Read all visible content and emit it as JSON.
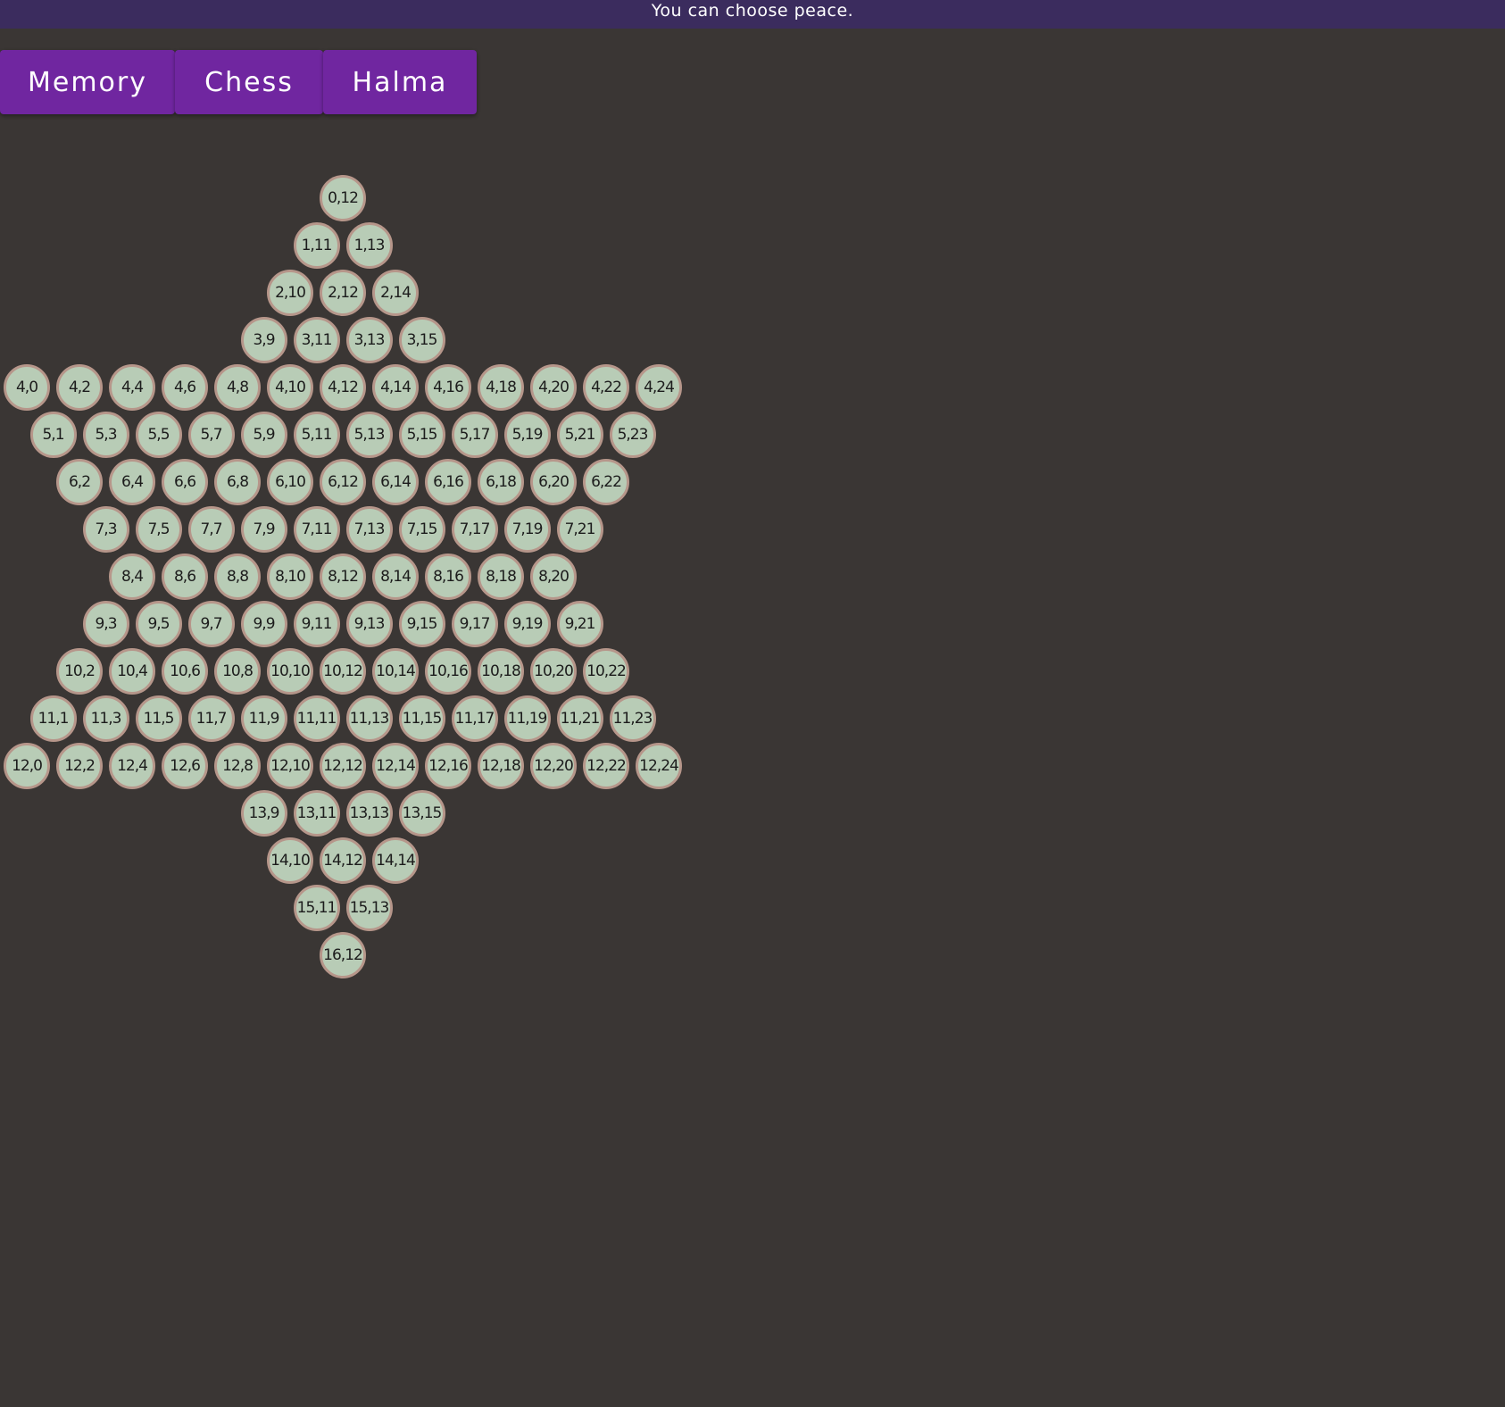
{
  "banner": {
    "text": "You can choose peace."
  },
  "menu": {
    "buttons": [
      {
        "name": "memory-button",
        "label": "Memory"
      },
      {
        "name": "chess-button",
        "label": "Chess"
      },
      {
        "name": "halma-button",
        "label": "Halma"
      }
    ]
  },
  "board": {
    "rows": [
      {
        "row": 0,
        "cols": [
          12
        ]
      },
      {
        "row": 1,
        "cols": [
          11,
          13
        ]
      },
      {
        "row": 2,
        "cols": [
          10,
          12,
          14
        ]
      },
      {
        "row": 3,
        "cols": [
          9,
          11,
          13,
          15
        ]
      },
      {
        "row": 4,
        "cols": [
          0,
          2,
          4,
          6,
          8,
          10,
          12,
          14,
          16,
          18,
          20,
          22,
          24
        ]
      },
      {
        "row": 5,
        "cols": [
          1,
          3,
          5,
          7,
          9,
          11,
          13,
          15,
          17,
          19,
          21,
          23
        ]
      },
      {
        "row": 6,
        "cols": [
          2,
          4,
          6,
          8,
          10,
          12,
          14,
          16,
          18,
          20,
          22
        ]
      },
      {
        "row": 7,
        "cols": [
          3,
          5,
          7,
          9,
          11,
          13,
          15,
          17,
          19,
          21
        ]
      },
      {
        "row": 8,
        "cols": [
          4,
          6,
          8,
          10,
          12,
          14,
          16,
          18,
          20
        ]
      },
      {
        "row": 9,
        "cols": [
          3,
          5,
          7,
          9,
          11,
          13,
          15,
          17,
          19,
          21
        ]
      },
      {
        "row": 10,
        "cols": [
          2,
          4,
          6,
          8,
          10,
          12,
          14,
          16,
          18,
          20,
          22
        ]
      },
      {
        "row": 11,
        "cols": [
          1,
          3,
          5,
          7,
          9,
          11,
          13,
          15,
          17,
          19,
          21,
          23
        ]
      },
      {
        "row": 12,
        "cols": [
          0,
          2,
          4,
          6,
          8,
          10,
          12,
          14,
          16,
          18,
          20,
          22,
          24
        ]
      },
      {
        "row": 13,
        "cols": [
          9,
          11,
          13,
          15
        ]
      },
      {
        "row": 14,
        "cols": [
          10,
          12,
          14
        ]
      },
      {
        "row": 15,
        "cols": [
          11,
          13
        ]
      },
      {
        "row": 16,
        "cols": [
          12
        ]
      }
    ],
    "cell_color": "#b8ccb6",
    "cell_border_color": "#b6968a"
  },
  "colors": {
    "background": "#3a3634",
    "banner": "#3b2c5e",
    "button": "#7026a0"
  }
}
